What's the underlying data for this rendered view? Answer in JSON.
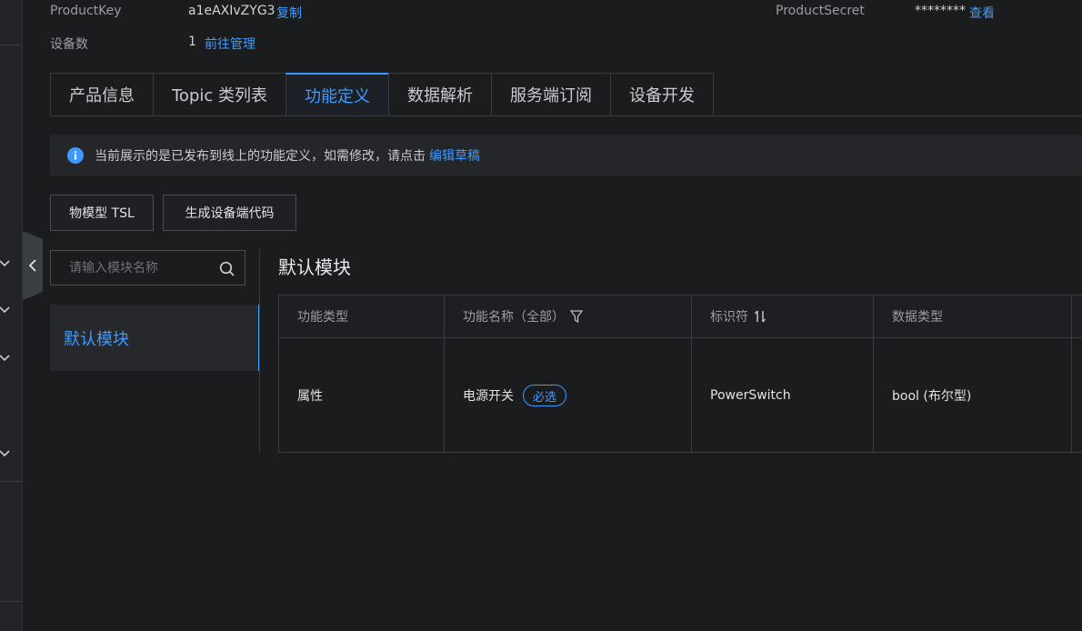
{
  "header": {
    "product_key_label": "ProductKey",
    "product_key_value": "a1eAXIvZYG3",
    "copy_link": "复制",
    "device_count_label": "设备数",
    "device_count_value": "1",
    "manage_link": "前往管理",
    "product_secret_label": "ProductSecret",
    "product_secret_value": "********",
    "view_link": "查看"
  },
  "tabs": [
    {
      "label": "产品信息",
      "active": false
    },
    {
      "label": "Topic 类列表",
      "active": false
    },
    {
      "label": "功能定义",
      "active": true
    },
    {
      "label": "数据解析",
      "active": false
    },
    {
      "label": "服务端订阅",
      "active": false
    },
    {
      "label": "设备开发",
      "active": false
    }
  ],
  "notice": {
    "text": "当前展示的是已发布到线上的功能定义，如需修改，请点击",
    "link": "编辑草稿"
  },
  "toolbar": {
    "tsl_button": "物模型 TSL",
    "gen_code_button": "生成设备端代码"
  },
  "module_panel": {
    "search_placeholder": "请输入模块名称",
    "selected_module": "默认模块"
  },
  "main": {
    "module_title": "默认模块",
    "table": {
      "headers": [
        "功能类型",
        "功能名称（全部）",
        "标识符",
        "数据类型"
      ],
      "rows": [
        {
          "type": "属性",
          "name": "电源开关",
          "badge": "必选",
          "identifier": "PowerSwitch",
          "data_type": "bool (布尔型)"
        }
      ]
    }
  },
  "colors": {
    "accent": "#3d9bff",
    "background": "#1b1c1e"
  }
}
